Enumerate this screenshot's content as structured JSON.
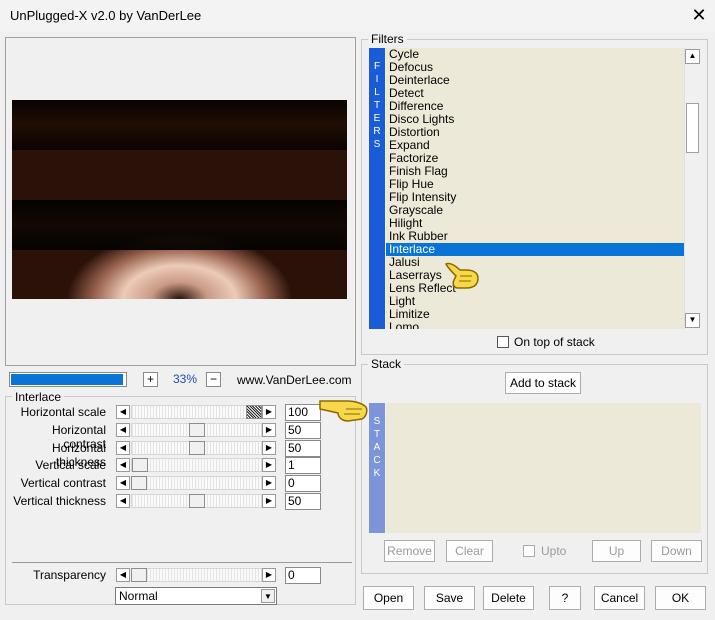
{
  "window": {
    "title": "UnPlugged-X v2.0 by VanDerLee",
    "close_glyph": "✕"
  },
  "preview": {
    "progress_fraction": 0.98,
    "zoom_plus": "+",
    "zoom_value": "33%",
    "zoom_minus": "−",
    "website": "www.VanDerLee.com"
  },
  "interlace": {
    "group_title": "Interlace",
    "sliders": [
      {
        "label": "Horizontal scale",
        "value": "100",
        "fraction": 1.0
      },
      {
        "label": "Horizontal contrast",
        "value": "50",
        "fraction": 0.5
      },
      {
        "label": "Horizontal thickness",
        "value": "50",
        "fraction": 0.5
      },
      {
        "label": "Vertical scale",
        "value": "1",
        "fraction": 0.01
      },
      {
        "label": "Vertical contrast",
        "value": "0",
        "fraction": 0.0
      },
      {
        "label": "Vertical thickness",
        "value": "50",
        "fraction": 0.5
      }
    ],
    "transparency": {
      "label": "Transparency",
      "value": "0",
      "fraction": 0.0
    },
    "blend_mode": "Normal"
  },
  "filters": {
    "group_title": "Filters",
    "strip_letters": [
      "F",
      "I",
      "L",
      "T",
      "E",
      "R",
      "S"
    ],
    "items": [
      "Cycle",
      "Defocus",
      "Deinterlace",
      "Detect",
      "Difference",
      "Disco Lights",
      "Distortion",
      "Expand",
      "Factorize",
      "Finish Flag",
      "Flip Hue",
      "Flip Intensity",
      "Grayscale",
      "Hilight",
      "Ink Rubber",
      "Interlace",
      "Jalusi",
      "Laserrays",
      "Lens Reflect",
      "Light",
      "Limitize",
      "Lomo"
    ],
    "selected": "Interlace",
    "on_top_label": "On top of stack",
    "on_top_checked": false
  },
  "stack": {
    "group_title": "Stack",
    "add_label": "Add to stack",
    "strip_letters": [
      "S",
      "T",
      "A",
      "C",
      "K"
    ],
    "remove_label": "Remove",
    "clear_label": "Clear",
    "upto_label": "Upto",
    "up_label": "Up",
    "down_label": "Down"
  },
  "buttons": {
    "open": "Open",
    "save": "Save",
    "delete": "Delete",
    "help": "?",
    "cancel": "Cancel",
    "ok": "OK"
  }
}
